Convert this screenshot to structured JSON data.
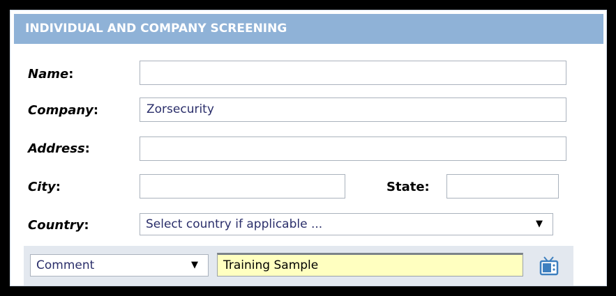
{
  "form": {
    "title": "INDIVIDUAL AND COMPANY SCREENING",
    "labels": {
      "name": "Name",
      "company": "Company",
      "address": "Address",
      "city": "City",
      "state": "State",
      "country": "Country",
      "colon": ":"
    },
    "values": {
      "name": "",
      "company": "Zorsecurity",
      "address": "",
      "city": "",
      "state": ""
    },
    "country_select": {
      "selected": "Select country if applicable ...",
      "arrow": "▼"
    },
    "note": {
      "type_selected": "Comment",
      "arrow": "▼",
      "text": "Training Sample",
      "icon": "tv-icon"
    }
  },
  "colors": {
    "header_bg": "#8fb2d7",
    "note_bg": "#ffffc0",
    "bottom_bar_bg": "#e3e8ef"
  }
}
